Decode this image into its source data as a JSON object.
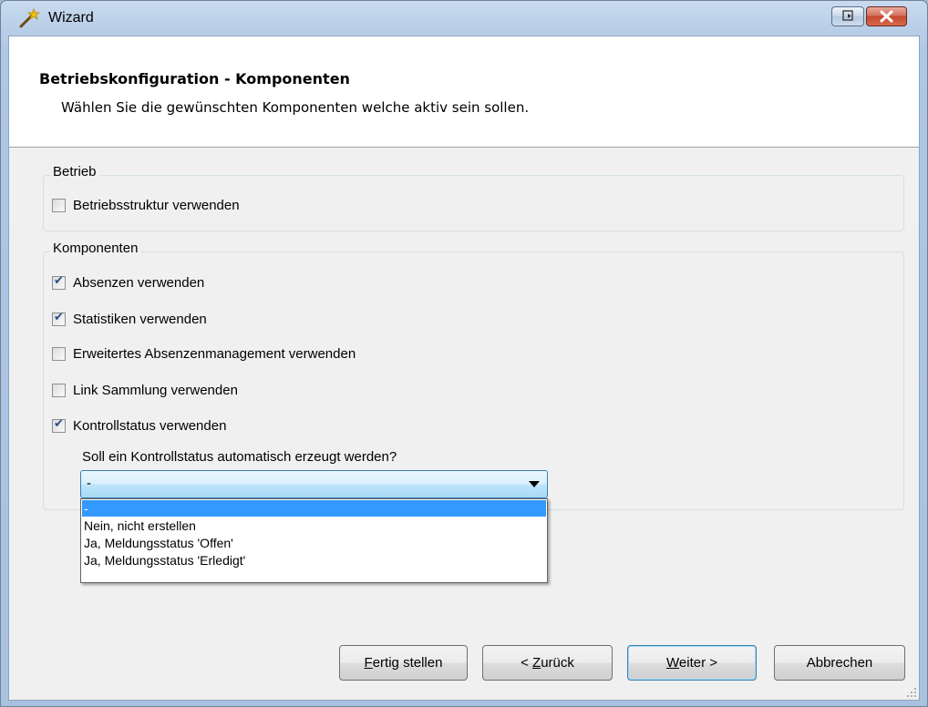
{
  "window": {
    "title": "Wizard",
    "colors": {
      "frame": "#aec7e3",
      "close": "#c4472d",
      "selection": "#3399ff"
    }
  },
  "header": {
    "title": "Betriebskonfiguration - Komponenten",
    "subtitle": "Wählen Sie die gewünschten Komponenten welche aktiv sein sollen."
  },
  "betrieb_group": {
    "legend": "Betrieb",
    "items": [
      {
        "label": "Betriebsstruktur verwenden",
        "checked": false
      }
    ]
  },
  "komponenten_group": {
    "legend": "Komponenten",
    "items": [
      {
        "label": "Absenzen verwenden",
        "checked": true
      },
      {
        "label": "Statistiken verwenden",
        "checked": true
      },
      {
        "label": "Erweitertes Absenzenmanagement verwenden",
        "checked": false
      },
      {
        "label": "Link Sammlung verwenden",
        "checked": false
      },
      {
        "label": "Kontrollstatus verwenden",
        "checked": true
      }
    ],
    "question": "Soll ein Kontrollstatus automatisch erzeugt werden?",
    "combo": {
      "selected": "-",
      "options": [
        "-",
        "Nein, nicht erstellen",
        "Ja, Meldungsstatus 'Offen'",
        "Ja, Meldungsstatus 'Erledigt'"
      ]
    }
  },
  "buttons": {
    "fertig": {
      "accel": "F",
      "rest": "ertig stellen"
    },
    "zurueck": {
      "pre": "< ",
      "accel": "Z",
      "rest": "urück"
    },
    "weiter": {
      "accel": "W",
      "rest": "eiter >"
    },
    "abbrechen": "Abbrechen"
  }
}
